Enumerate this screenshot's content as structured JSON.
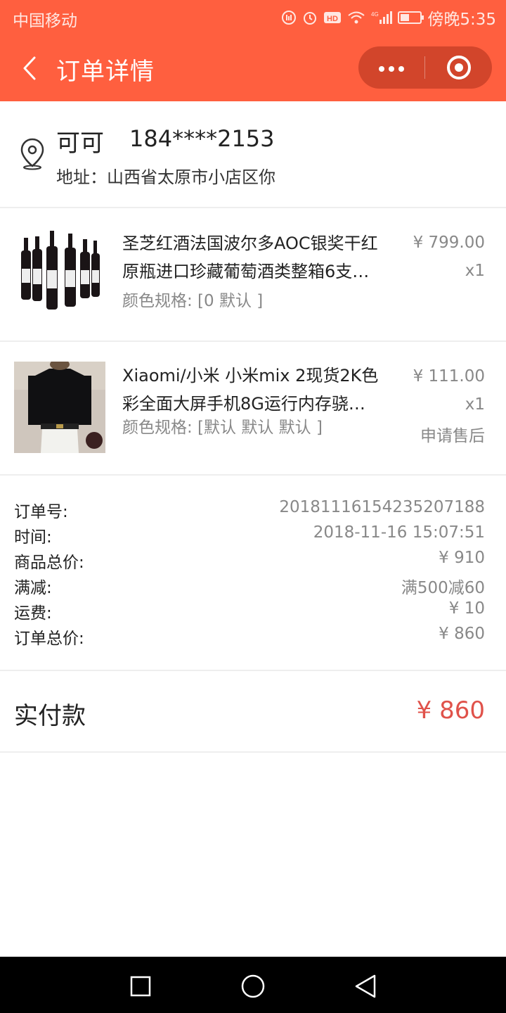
{
  "status_bar": {
    "carrier": "中国移动",
    "time": "傍晚5:35",
    "network": "4G",
    "battery_level": 0.45
  },
  "nav": {
    "title": "订单详情",
    "back_icon": "chevron-left-icon",
    "more_icon": "more-dots-icon",
    "close_icon": "target-circle-icon"
  },
  "address": {
    "name": "可可",
    "phone": "184****2153",
    "address_text": "地址：山西省太原市小店区你",
    "icon": "location-pin-icon"
  },
  "products": [
    {
      "title_line1": "圣芝红酒法国波尔多AOC银奖干红",
      "title_line2": "原瓶进口珍藏葡萄酒类整箱6支…",
      "spec": "颜色规格: [0 默认 ]",
      "price": "¥ 799.00",
      "qty": "x1",
      "image": "wine-bottles-image"
    },
    {
      "title_line1": "Xiaomi/小米 小米mix 2现货2K色",
      "title_line2": "彩全面大屏手机8G运行内存骁…",
      "spec": "颜色规格: [默认 默认 默认 ]",
      "price": "¥ 111.00",
      "qty": "x1",
      "after_sale": "申请售后",
      "image": "black-shirt-model-image"
    }
  ],
  "order_info": [
    {
      "label": "订单号:",
      "value": "20181116154235207188"
    },
    {
      "label": "时间:",
      "value": "2018-11-16 15:07:51"
    },
    {
      "label": "商品总价:",
      "value": "¥ 910"
    },
    {
      "label": "满减:",
      "value": "满500减60"
    },
    {
      "label": "运费:",
      "value": "¥ 10"
    },
    {
      "label": "订单总价:",
      "value": "¥ 860"
    }
  ],
  "paid": {
    "label": "实付款",
    "value": "¥ 860"
  },
  "colors": {
    "header": "#ff5f3f",
    "capsule": "#d2452b",
    "paid_value": "#e0524a"
  },
  "system_nav": {
    "recent_icon": "square-icon",
    "home_icon": "circle-icon",
    "back_icon": "triangle-back-icon"
  }
}
